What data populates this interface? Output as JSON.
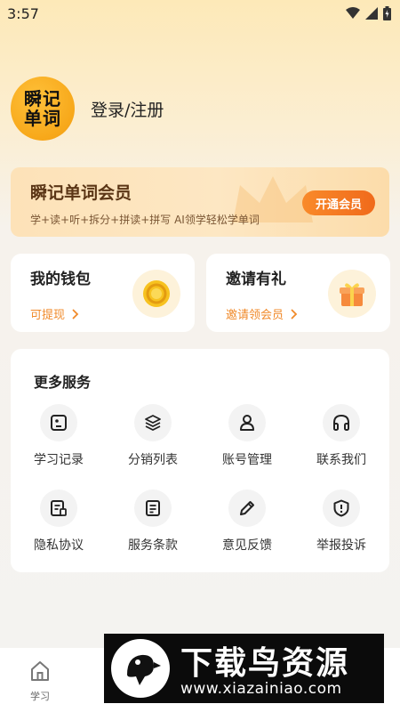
{
  "status_bar": {
    "time": "3:57"
  },
  "profile": {
    "avatar_text_line1": "瞬记",
    "avatar_text_line2": "单词",
    "login_text": "登录/注册"
  },
  "vip": {
    "title": "瞬记单词会员",
    "subtitle": "学+读+听+拆分+拼读+拼写 AI领学轻松学单词",
    "button": "开通会员"
  },
  "wallet": {
    "title": "我的钱包",
    "link": "可提现"
  },
  "invite": {
    "title": "邀请有礼",
    "link": "邀请领会员"
  },
  "services": {
    "title": "更多服务",
    "items": [
      {
        "label": "学习记录",
        "icon": "record-icon"
      },
      {
        "label": "分销列表",
        "icon": "layers-icon"
      },
      {
        "label": "账号管理",
        "icon": "user-icon"
      },
      {
        "label": "联系我们",
        "icon": "headphones-icon"
      },
      {
        "label": "隐私协议",
        "icon": "privacy-doc-icon"
      },
      {
        "label": "服务条款",
        "icon": "terms-doc-icon"
      },
      {
        "label": "意见反馈",
        "icon": "pencil-icon"
      },
      {
        "label": "举报投诉",
        "icon": "report-shield-icon"
      }
    ]
  },
  "tabbar": {
    "learn_label": "学习"
  },
  "watermark": {
    "title": "下载鸟资源",
    "url": "www.xiazainiao.com"
  },
  "colors": {
    "accent": "#f06a1b",
    "link": "#f08a2a",
    "gold": "#f7a81a"
  }
}
